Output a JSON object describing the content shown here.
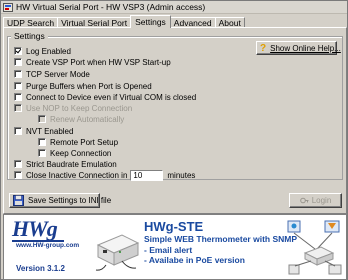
{
  "window": {
    "title": "HW Virtual Serial Port - HW VSP3 (Admin access)"
  },
  "tabs": [
    {
      "label": "UDP Search"
    },
    {
      "label": "Virtual Serial Port"
    },
    {
      "label": "Settings"
    },
    {
      "label": "Advanced"
    },
    {
      "label": "About"
    }
  ],
  "settings": {
    "group_label": "Settings",
    "help_button": "Show Online Help...",
    "options": [
      {
        "label": "Log Enabled",
        "checked": true,
        "enabled": true
      },
      {
        "label": "Create VSP Port when HW VSP Start-up",
        "checked": false,
        "enabled": true
      },
      {
        "label": "TCP Server Mode",
        "checked": false,
        "enabled": true
      },
      {
        "label": "Purge Buffers when Port is Opened",
        "checked": false,
        "enabled": true
      },
      {
        "label": "Connect to Device even if Virtual COM is closed",
        "checked": false,
        "enabled": true
      },
      {
        "label": "Use NOP to Keep Connection",
        "checked": false,
        "enabled": false
      },
      {
        "label": "Renew Automatically",
        "checked": false,
        "enabled": false
      },
      {
        "label": "NVT Enabled",
        "checked": false,
        "enabled": true
      },
      {
        "label": "Remote Port Setup",
        "checked": false,
        "enabled": true
      },
      {
        "label": "Keep Connection",
        "checked": false,
        "enabled": true
      },
      {
        "label": "Strict Baudrate Emulation",
        "checked": false,
        "enabled": true
      },
      {
        "label": "Close Inactive Connection in",
        "checked": false,
        "enabled": true
      }
    ],
    "inactive_value": "10",
    "inactive_unit": "minutes"
  },
  "buttons": {
    "save": "Save Settings to INI file",
    "login": "Login"
  },
  "banner": {
    "logo_hw": "HW",
    "logo_g": "g",
    "url": "www.HW-group.com",
    "version": "Version  3.1.2",
    "product_name": "HWg-STE",
    "line1": "Simple WEB Thermometer with SNMP",
    "line2": "- Email alert",
    "line3": "- Availabe in PoE version"
  },
  "colors": {
    "brand_blue": "#1a4aa0",
    "window_face": "#d4d0c8"
  }
}
